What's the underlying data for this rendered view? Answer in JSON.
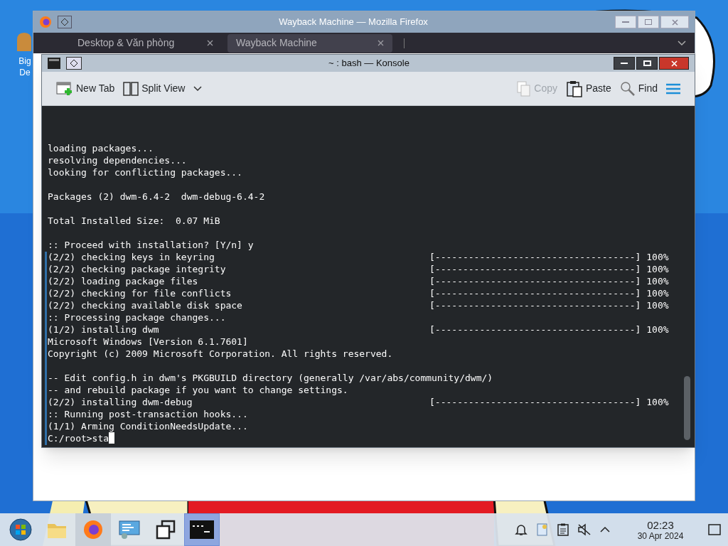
{
  "desktop_icons": [
    {
      "lines": [
        "Big",
        "De"
      ]
    }
  ],
  "background_window": {
    "title": "Wayback Machine — Mozilla Firefox",
    "tabs": [
      {
        "label": "Desktop & Văn phòng",
        "selected": false
      },
      {
        "label": "Wayback Machine",
        "selected": true
      }
    ]
  },
  "window": {
    "title": "~ : bash — Konsole"
  },
  "toolbar": [
    {
      "kind": "new_tab",
      "label": "New Tab",
      "disabled": false
    },
    {
      "kind": "split_view",
      "label": "Split View",
      "disabled": false
    },
    {
      "kind": "copy",
      "label": "Copy",
      "disabled": true
    },
    {
      "kind": "paste",
      "label": "Paste",
      "disabled": false
    },
    {
      "kind": "find",
      "label": "Find",
      "disabled": false
    },
    {
      "kind": "menu"
    }
  ],
  "terminal": {
    "lines": [
      {
        "text": "loading packages..."
      },
      {
        "text": "resolving dependencies..."
      },
      {
        "text": "looking for conflicting packages..."
      },
      {
        "kind": "blank"
      },
      {
        "text": "Packages (2) dwm-6.4-2  dwm-debug-6.4-2"
      },
      {
        "kind": "blank"
      },
      {
        "text": "Total Installed Size:  0.07 MiB"
      },
      {
        "kind": "blank"
      },
      {
        "text": ":: Proceed with installation? [Y/n] y"
      },
      {
        "text": "(2/2) checking keys in keyring",
        "progress": "[------------------------------------] 100%"
      },
      {
        "text": "(2/2) checking package integrity",
        "progress": "[------------------------------------] 100%"
      },
      {
        "text": "(2/2) loading package files",
        "progress": "[------------------------------------] 100%"
      },
      {
        "text": "(2/2) checking for file conflicts",
        "progress": "[------------------------------------] 100%"
      },
      {
        "text": "(2/2) checking available disk space",
        "progress": "[------------------------------------] 100%"
      },
      {
        "text": ":: Processing package changes..."
      },
      {
        "text": "(1/2) installing dwm",
        "progress": "[------------------------------------] 100%"
      },
      {
        "text": "Microsoft Windows [Version 6.1.7601]"
      },
      {
        "text": "Copyright (c) 2009 Microsoft Corporation. All rights reserved."
      },
      {
        "kind": "blank"
      },
      {
        "text": "-- Edit config.h in dwm's PKGBUILD directory (generally /var/abs/community/dwm/)"
      },
      {
        "text": "-- and rebuild package if you want to change settings."
      },
      {
        "text": "(2/2) installing dwm-debug",
        "progress": "[------------------------------------] 100%"
      },
      {
        "text": ":: Running post-transaction hooks..."
      },
      {
        "text": "(1/1) Arming ConditionNeedsUpdate..."
      },
      {
        "text": "C:/root>sta",
        "cursor": true
      }
    ]
  },
  "taskbar": {
    "apps": [
      {
        "kind": "start",
        "selected": false
      },
      {
        "kind": "files",
        "selected": false
      },
      {
        "kind": "browser",
        "selected": false
      },
      {
        "kind": "settings",
        "selected": false
      },
      {
        "kind": "windows",
        "selected": false
      },
      {
        "kind": "terminal",
        "selected": true
      }
    ],
    "tray": [
      {
        "kind": "bell"
      },
      {
        "kind": "notes"
      },
      {
        "kind": "clipboard"
      },
      {
        "kind": "muted"
      },
      {
        "kind": "expand"
      }
    ],
    "clock": {
      "time": "02:23",
      "date": "30 Apr 2024"
    }
  }
}
